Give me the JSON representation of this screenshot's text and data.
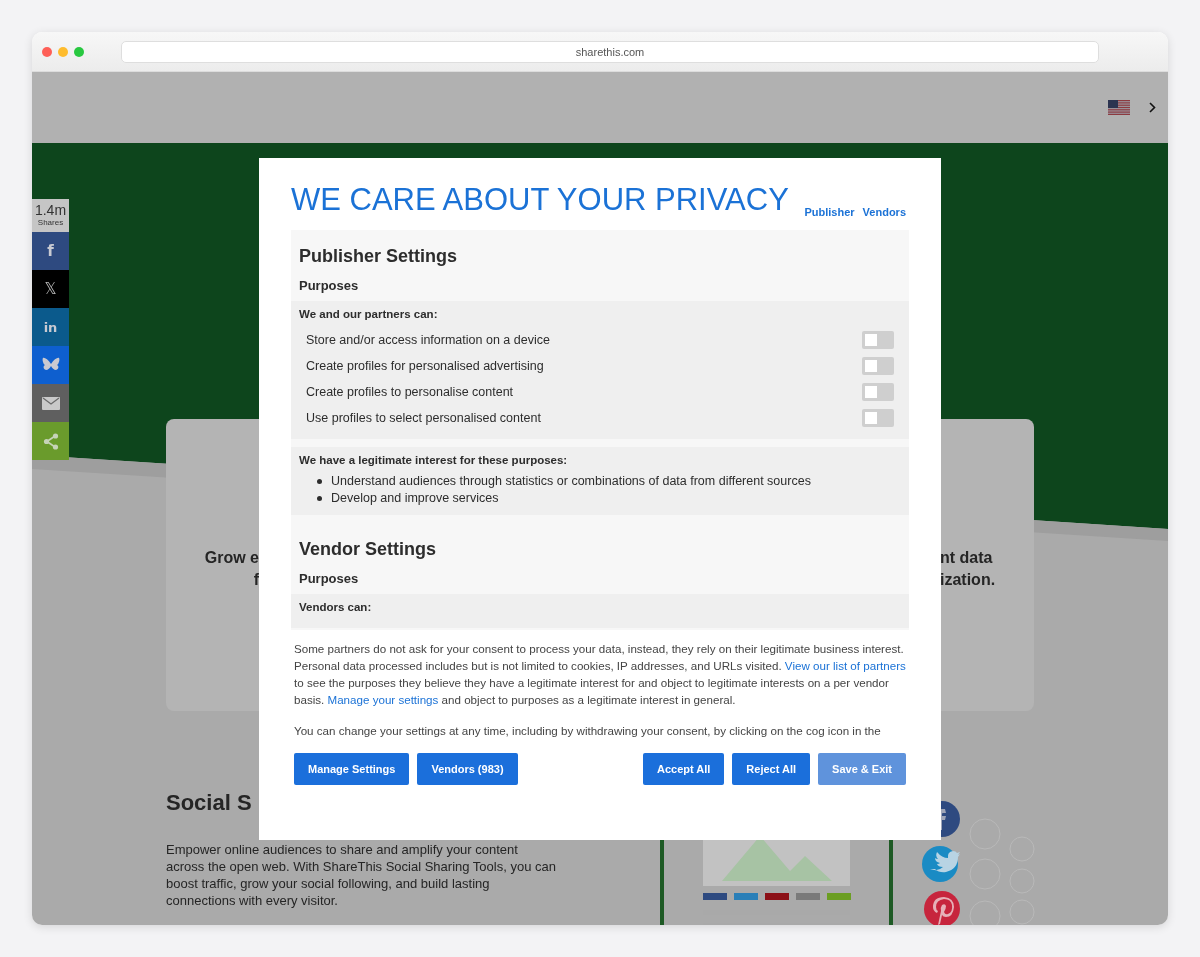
{
  "browser": {
    "url": "sharethis.com"
  },
  "share_bar": {
    "count": "1.4m",
    "label": "Shares",
    "buttons": [
      {
        "kind": "facebook",
        "label": "f"
      },
      {
        "kind": "x",
        "label": "𝕏"
      },
      {
        "kind": "linkedin",
        "label": "in"
      },
      {
        "kind": "bluesky"
      },
      {
        "kind": "email"
      },
      {
        "kind": "share"
      }
    ]
  },
  "hero_card": {
    "left_lines": [
      "Grow e",
      "f"
    ],
    "right_lines": [
      "nt data",
      "ization."
    ]
  },
  "social_section": {
    "heading": "Social S",
    "paragraph": "Empower online audiences to share and amplify your content across the open web. With ShareThis Social Sharing Tools, you can boost traffic, grow your social following, and build lasting connections with every visitor."
  },
  "modal": {
    "title": "WE CARE ABOUT YOUR PRIVACY",
    "nav_links": [
      "Publisher",
      "Vendors"
    ],
    "sections": [
      {
        "heading": "Publisher Settings",
        "subheading": "Purposes",
        "groups": [
          {
            "kind": "toggles",
            "title": "We and our partners can:",
            "items": [
              {
                "label": "Store and/or access information on a device",
                "on": false
              },
              {
                "label": "Create profiles for personalised advertising",
                "on": false
              },
              {
                "label": "Create profiles to personalise content",
                "on": false
              },
              {
                "label": "Use profiles to select personalised content",
                "on": false
              }
            ]
          },
          {
            "kind": "bullets",
            "title": "We have a legitimate interest for these purposes:",
            "items": [
              {
                "label": "Understand audiences through statistics or combinations of data from different sources"
              },
              {
                "label": "Develop and improve services"
              }
            ]
          }
        ]
      },
      {
        "heading": "Vendor Settings",
        "subheading": "Purposes",
        "groups": [
          {
            "kind": "toggles",
            "title": "Vendors can:"
          }
        ]
      }
    ],
    "notice": [
      [
        {
          "kind": "text",
          "text": "Some partners do not ask for your consent to process your data, instead, they rely on their legitimate business interest. Personal data processed includes but is not limited to cookies, IP addresses, and URLs visited. "
        },
        {
          "kind": "link",
          "text": "View our list of partners"
        },
        {
          "kind": "text",
          "text": " to see the purposes they believe they have a legitimate interest for and object to legitimate interests on a per vendor basis. "
        },
        {
          "kind": "link",
          "text": "Manage your settings"
        },
        {
          "kind": "text",
          "text": " and object to purposes as a legitimate interest in general."
        }
      ],
      [
        {
          "kind": "text",
          "text": "You can change your settings at any time, including by withdrawing your consent, by clicking on the cog icon in the"
        }
      ]
    ],
    "buttons_left": [
      {
        "label": "Manage Settings",
        "disabled": false
      },
      {
        "label": "Vendors (983)",
        "disabled": false
      }
    ],
    "buttons_right": [
      {
        "label": "Accept All",
        "disabled": false
      },
      {
        "label": "Reject All",
        "disabled": false
      },
      {
        "label": "Save & Exit",
        "disabled": true
      }
    ]
  }
}
